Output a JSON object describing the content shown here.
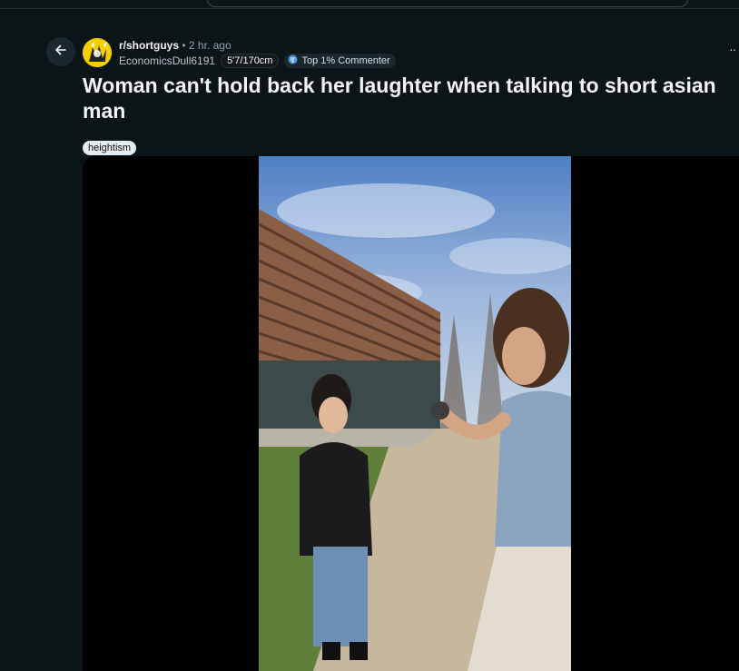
{
  "post": {
    "subreddit": "r/shortguys",
    "separator": "•",
    "time": "2 hr. ago",
    "author": "EconomicsDull6191",
    "author_flair": "5'7/170cm",
    "badge": "Top 1% Commenter",
    "title": "Woman can't hold back her laughter when talking to short asian man",
    "tag": "heightism"
  },
  "icons": {
    "back": "arrow-left-icon",
    "more": "more-horizontal-icon",
    "badge": "commenter-badge-icon"
  },
  "colors": {
    "background": "#0b1416",
    "title_text": "#f2f4f5",
    "avatar_yellow": "#f5d000",
    "badge_accent": "#4b93d9"
  }
}
